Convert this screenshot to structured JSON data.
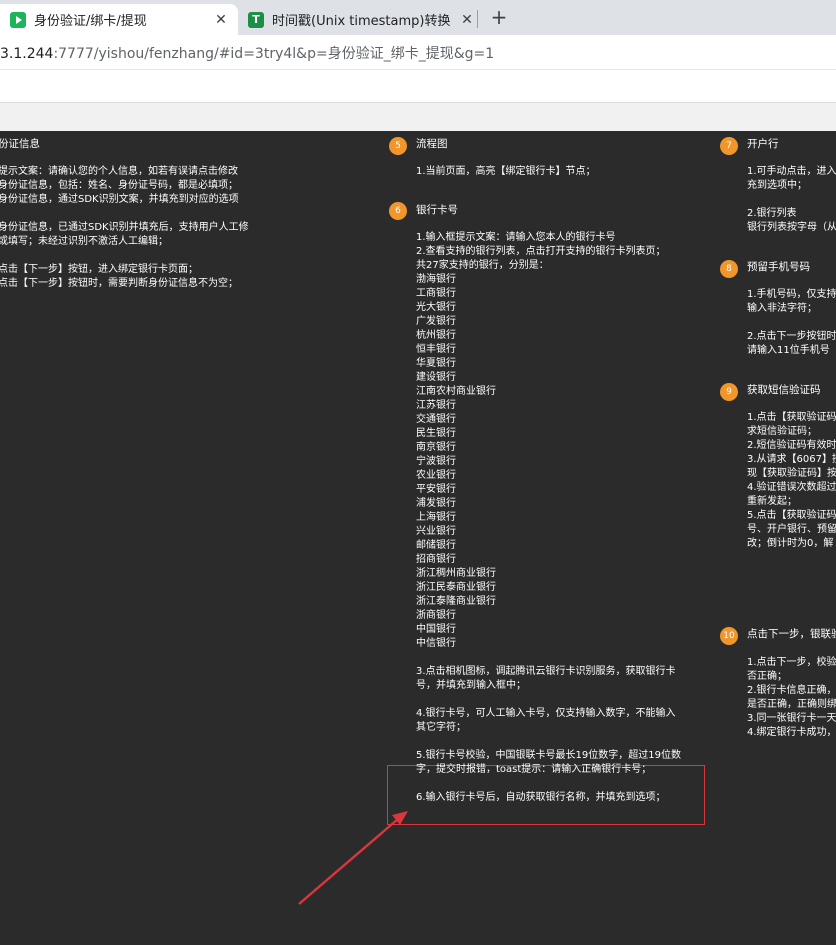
{
  "browser": {
    "tabs": [
      {
        "title": "身份验证/绑卡/提现",
        "active": true
      },
      {
        "title": "时间戳(Unix timestamp)转换工具",
        "active": false
      }
    ],
    "url_host": "3.1.244",
    "url_path": ":7777/yishou/fenzhang/#id=3try4l&p=身份验证_绑卡_提现&g=1"
  },
  "col_left": {
    "title": "份证信息",
    "lines": [
      {
        "text": "提示文案：请确认您的个人信息，如若有误请点击修改",
        "gap": false
      },
      {
        "text": "身份证信息，包括：姓名、身份证号码，都是必填项；",
        "gap": false
      },
      {
        "text": "身份证信息，通过SDK识别文案，并填充到对应的选项",
        "gap": false
      },
      {
        "text": "身份证信息，已通过SDK识别并填充后，支持用户人工修",
        "gap": true
      },
      {
        "text": "或填写；未经过识别不激活人工编辑；",
        "gap": false
      },
      {
        "text": "点击【下一步】按钮，进入绑定银行卡页面；",
        "gap": true
      },
      {
        "text": "点击【下一步】按钮时，需要判断身份证信息不为空；",
        "gap": false
      }
    ]
  },
  "col_mid": {
    "sec5": {
      "num": "5",
      "title": "流程图",
      "lines": [
        "1.当前页面，高亮【绑定银行卡】节点；"
      ]
    },
    "sec6": {
      "num": "6",
      "title": "银行卡号",
      "intro": [
        "1.输入框提示文案：请输入您本人的银行卡号",
        "2.查看支持的银行列表，点击打开支持的银行卡列表页；",
        "共27家支持的银行，分别是："
      ],
      "banks": [
        "渤海银行",
        "工商银行",
        "光大银行",
        "广发银行",
        "杭州银行",
        "恒丰银行",
        "华夏银行",
        "建设银行",
        "江南农村商业银行",
        "江苏银行",
        "交通银行",
        "民生银行",
        "南京银行",
        "宁波银行",
        "农业银行",
        "平安银行",
        "浦发银行",
        "上海银行",
        "兴业银行",
        "邮储银行",
        "招商银行",
        "浙江稠州商业银行",
        "浙江民泰商业银行",
        "浙江泰隆商业银行",
        "浙商银行",
        "中国银行",
        "中信银行"
      ],
      "notes": [
        [
          "3.点击相机图标，调起腾讯云银行卡识别服务，获取银行卡",
          "号，并填充到输入框中；"
        ],
        [
          "4.银行卡号，可人工输入卡号，仅支持输入数字，不能输入",
          "其它字符；"
        ],
        [
          "5.银行卡号校验，中国银联卡号最长19位数字，超过19位数",
          "字，提交时报错，toast提示：请输入正确银行卡号；"
        ],
        [
          "6.输入银行卡号后，自动获取银行名称，并填充到选项；"
        ]
      ]
    }
  },
  "col_right": {
    "sec7": {
      "num": "7",
      "title": "开户行",
      "lines": [
        {
          "text": "1.可手动点击，进入",
          "gap": false
        },
        {
          "text": "充到选项中；",
          "gap": false
        },
        {
          "text": "2.银行列表",
          "gap": true
        },
        {
          "text": "银行列表按字母（从",
          "gap": false
        }
      ]
    },
    "sec8": {
      "num": "8",
      "title": "预留手机号码",
      "lines": [
        {
          "text": "1.手机号码，仅支持",
          "gap": false
        },
        {
          "text": "输入非法字符；",
          "gap": false
        },
        {
          "text": "2.点击下一步按钮时",
          "gap": true
        },
        {
          "text": "请输入11位手机号",
          "gap": false
        }
      ]
    },
    "sec9": {
      "num": "9",
      "title": "获取短信验证码",
      "lines": [
        "1.点击【获取验证码",
        "求短信验证码；",
        "2.短信验证码有效时",
        "3.从请求【6067】接",
        "现【获取验证码】按",
        "4.验证错误次数超过",
        "重新发起；",
        "5.点击【获取验证码",
        "号、开户银行、预留",
        "改；倒计时为0，解"
      ]
    },
    "sec10": {
      "num": "10",
      "title": "点击下一步，银联验",
      "lines": [
        "1.点击下一步，校验",
        "否正确；",
        "2.银行卡信息正确，",
        "是否正确，正确则绑",
        "3.同一张银行卡一天",
        "4.绑定银行卡成功，"
      ]
    }
  },
  "colors": {
    "badge": "#f0962a",
    "highlight": "#d9363e",
    "canvas": "#2b2b2b"
  }
}
